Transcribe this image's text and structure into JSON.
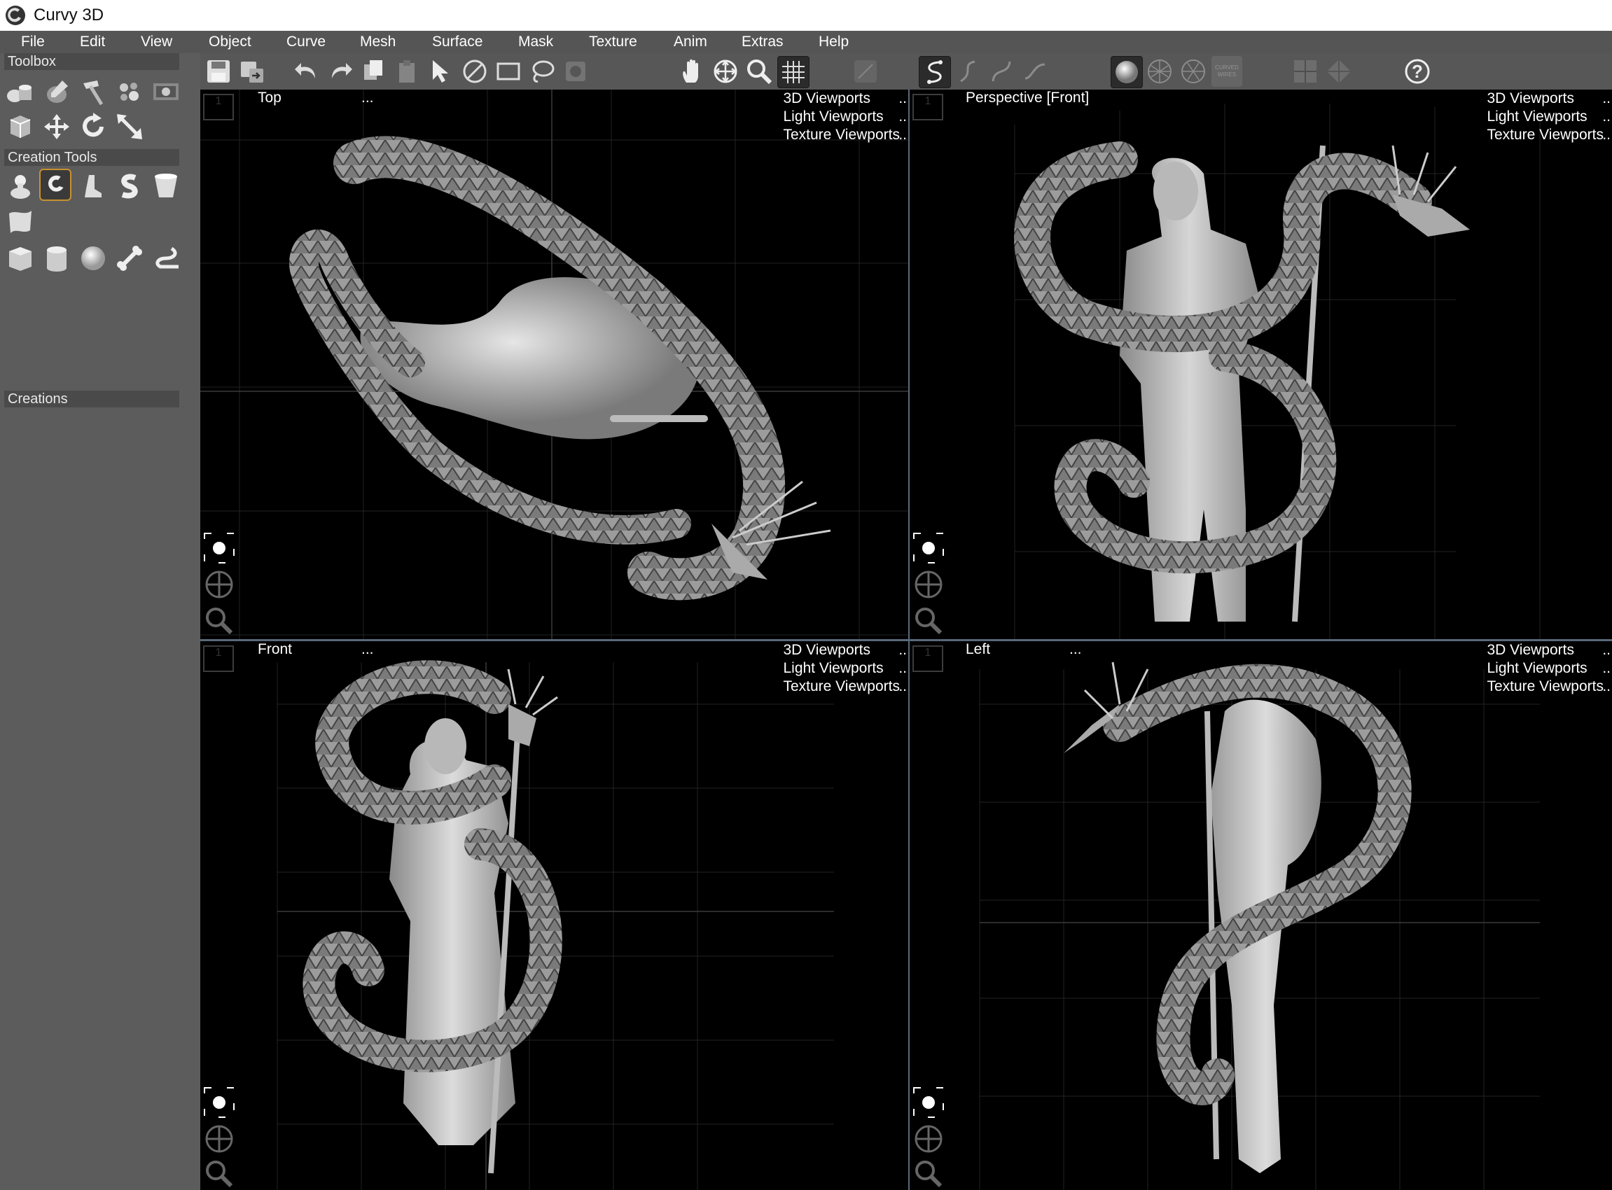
{
  "app": {
    "title": "Curvy 3D"
  },
  "menu": [
    "File",
    "Edit",
    "View",
    "Object",
    "Curve",
    "Mesh",
    "Surface",
    "Mask",
    "Texture",
    "Anim",
    "Extras",
    "Help"
  ],
  "toolbar": {
    "icons": [
      "save-icon",
      "export-icon",
      "undo-icon",
      "redo-icon",
      "copy-icon",
      "paste-icon",
      "select-arrow-icon",
      "deselect-icon",
      "rect-select-icon",
      "lasso-icon",
      "mask-icon",
      "pan-hand-icon",
      "move-view-icon",
      "zoom-icon",
      "grid-icon",
      "snap-icon",
      "curve-tool-icon",
      "curve-tool-2-icon",
      "curve-tool-3-icon",
      "curve-tool-4-icon",
      "shaded-sphere-icon",
      "wire-sphere-icon",
      "wire-sphere-2-icon",
      "curved-wires-icon",
      "quad-view-icon",
      "rotate-view-icon",
      "help-icon"
    ],
    "curved_wires_label": "CURVED WIRES",
    "help_label": "?"
  },
  "left_panel": {
    "toolbox_title": "Toolbox",
    "creation_tools_title": "Creation Tools",
    "creations_title": "Creations",
    "toolbox_icons": [
      "primitives-icon",
      "sculpt-icon",
      "hammer-icon",
      "bubbles-icon",
      "image-plane-icon",
      "cube-icon",
      "move-icon",
      "rotate-icon",
      "scale-icon"
    ],
    "creation_icons": [
      "blob-icon",
      "curl-icon",
      "boot-icon",
      "s-curve-icon",
      "cup-icon",
      "cloth-icon",
      "box-icon",
      "cylinder-icon",
      "sphere-icon",
      "bone-icon",
      "hook-icon"
    ]
  },
  "viewports": [
    {
      "name": "Top",
      "dots": "...",
      "number": "1",
      "links": [
        "3D Viewports",
        "Light Viewports",
        "Texture Viewports"
      ],
      "link_dots": ".."
    },
    {
      "name": "Perspective [Front]",
      "dots": "",
      "number": "1",
      "links": [
        "3D Viewports",
        "Light Viewports",
        "Texture Viewports"
      ],
      "link_dots": ".."
    },
    {
      "name": "Front",
      "dots": "...",
      "number": "1",
      "links": [
        "3D Viewports",
        "Light Viewports",
        "Texture Viewports"
      ],
      "link_dots": ".."
    },
    {
      "name": "Left",
      "dots": "...",
      "number": "1",
      "links": [
        "3D Viewports",
        "Light Viewports",
        "Texture Viewports"
      ],
      "link_dots": ".."
    }
  ],
  "colors": {
    "menu_bg": "#555555",
    "panel_bg": "#5c5c5c",
    "viewport_bg": "#000000",
    "grid": "#2e2e2e",
    "selection_accent": "#c9912f",
    "model_grey": "#a8a8a8"
  }
}
